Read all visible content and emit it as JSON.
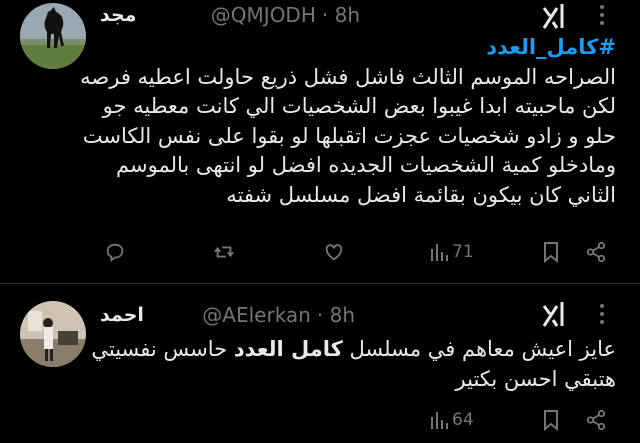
{
  "tweets": [
    {
      "name": "مجد",
      "handle": "@QMJODH",
      "time": "· 8h",
      "hashtag": "#كامل_العدد",
      "lines": [
        "الصراحه الموسم الثالث فاشل فشل ذريع حاولت اعطيه فرصه",
        "لكن ماحبيته ابدا غيبوا بعض الشخصيات الي كانت معطيه جو",
        "حلو و زادو شخصيات عجزت اتقبلها لو بقوا على نفس الكاست",
        "ومادخلو كمية الشخصيات الجديده افضل لو انتهى بالموسم",
        "الثاني كان بيكون بقائمة افضل مسلسل شفته"
      ],
      "views": "71",
      "avatar_icon": "horse-silhouette-avatar"
    },
    {
      "name": "احمد",
      "handle": "@AElerkan",
      "time": "· 8h",
      "line1_pre": "عايز اعيش معاهم في مسلسل ",
      "line1_bold": "كامل العدد",
      "line1_post": " حاسس نفسيتي",
      "line2": "هتبقي احسن بكتير",
      "views": "64",
      "avatar_icon": "room-photo-avatar"
    }
  ],
  "icons": [
    "grok-icon",
    "more-options-icon",
    "reply-icon",
    "retweet-icon",
    "like-icon",
    "views-icon",
    "bookmark-icon",
    "share-icon"
  ],
  "colors": {
    "background": "#000000",
    "text": "#e7e9ea",
    "muted": "#71767b",
    "accent": "#1d9bf0",
    "divider": "#2f3336"
  }
}
